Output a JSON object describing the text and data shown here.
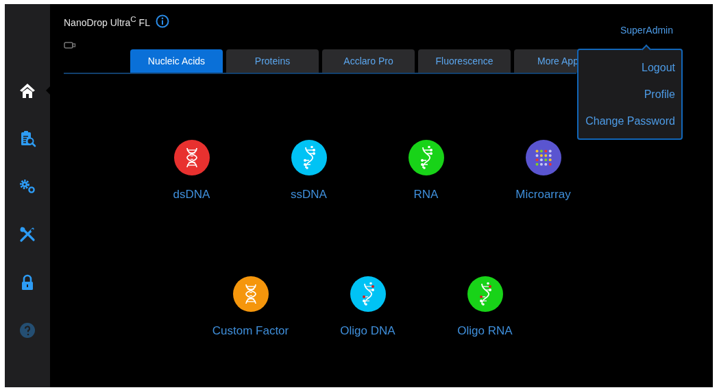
{
  "header": {
    "title": "NanoDrop Ultra$^{C}$ FL"
  },
  "sidebar": {
    "items": [
      {
        "kind": "home",
        "selected": true,
        "disabled": false
      },
      {
        "kind": "report",
        "selected": false,
        "disabled": false
      },
      {
        "kind": "settings",
        "selected": false,
        "disabled": false
      },
      {
        "kind": "tools",
        "selected": false,
        "disabled": false
      },
      {
        "kind": "lock",
        "selected": false,
        "disabled": false
      },
      {
        "kind": "help",
        "selected": false,
        "disabled": true
      }
    ]
  },
  "tabs": [
    {
      "label": "Nucleic Acids",
      "selected": true
    },
    {
      "label": "Proteins",
      "selected": false
    },
    {
      "label": "Acclaro Pro",
      "selected": false
    },
    {
      "label": "Fluorescence",
      "selected": false
    },
    {
      "label": "More App",
      "selected": false
    }
  ],
  "user_menu": {
    "label": "SuperAdmin",
    "expanded": true,
    "items": [
      "Logout",
      "Profile",
      "Change Password"
    ]
  },
  "app_rows": [
    {
      "apps": [
        {
          "label": "dsDNA",
          "kind": "double-helix",
          "color": "#e8312f"
        },
        {
          "label": "ssDNA",
          "kind": "single-strand",
          "color": "#00c3f5"
        },
        {
          "label": "RNA",
          "kind": "single-strand",
          "color": "#18d318"
        },
        {
          "label": "Microarray",
          "kind": "microarray",
          "color": "#5a55d0"
        }
      ]
    },
    {
      "apps": [
        {
          "label": "Custom Factor",
          "kind": "double-helix",
          "color": "#f5960c"
        },
        {
          "label": "Oligo DNA",
          "kind": "oligo",
          "color": "#00c3f5"
        },
        {
          "label": "Oligo RNA",
          "kind": "oligo",
          "color": "#18d318"
        }
      ]
    }
  ]
}
